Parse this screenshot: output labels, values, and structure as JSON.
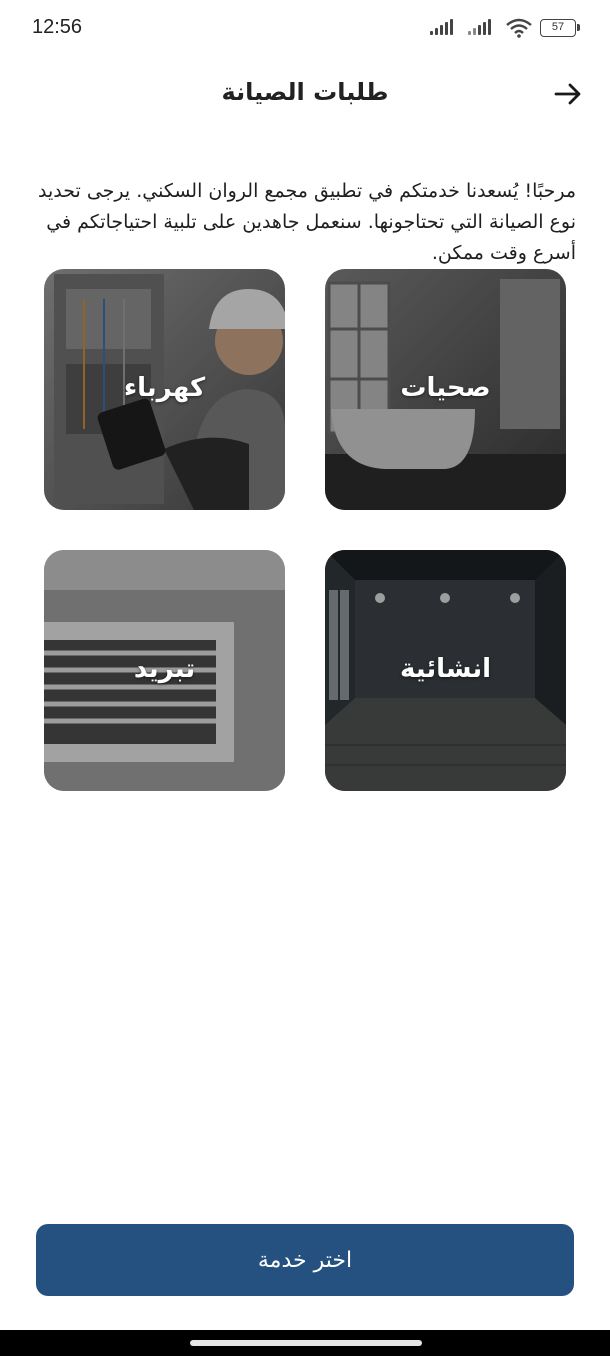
{
  "status_bar": {
    "time": "12:56",
    "battery": "57",
    "icons": [
      "signal-icon",
      "signal-icon",
      "wifi-icon",
      "battery-icon"
    ]
  },
  "header": {
    "title": "طلبات الصيانة",
    "back_icon": "arrow-right-icon"
  },
  "intro": {
    "text": "مرحبًا! يُسعدنا خدمتكم في تطبيق مجمع الروان السكني. يرجى تحديد نوع الصيانة التي تحتاجونها. سنعمل جاهدين على تلبية احتياجاتكم في أسرع وقت ممكن."
  },
  "services": {
    "sanitary": "صحيات",
    "electric": "كهرباء",
    "construction": "انشائية",
    "cooling": "تبريد"
  },
  "footer": {
    "button_label": "اختر خدمة",
    "button_color": "#255180"
  }
}
